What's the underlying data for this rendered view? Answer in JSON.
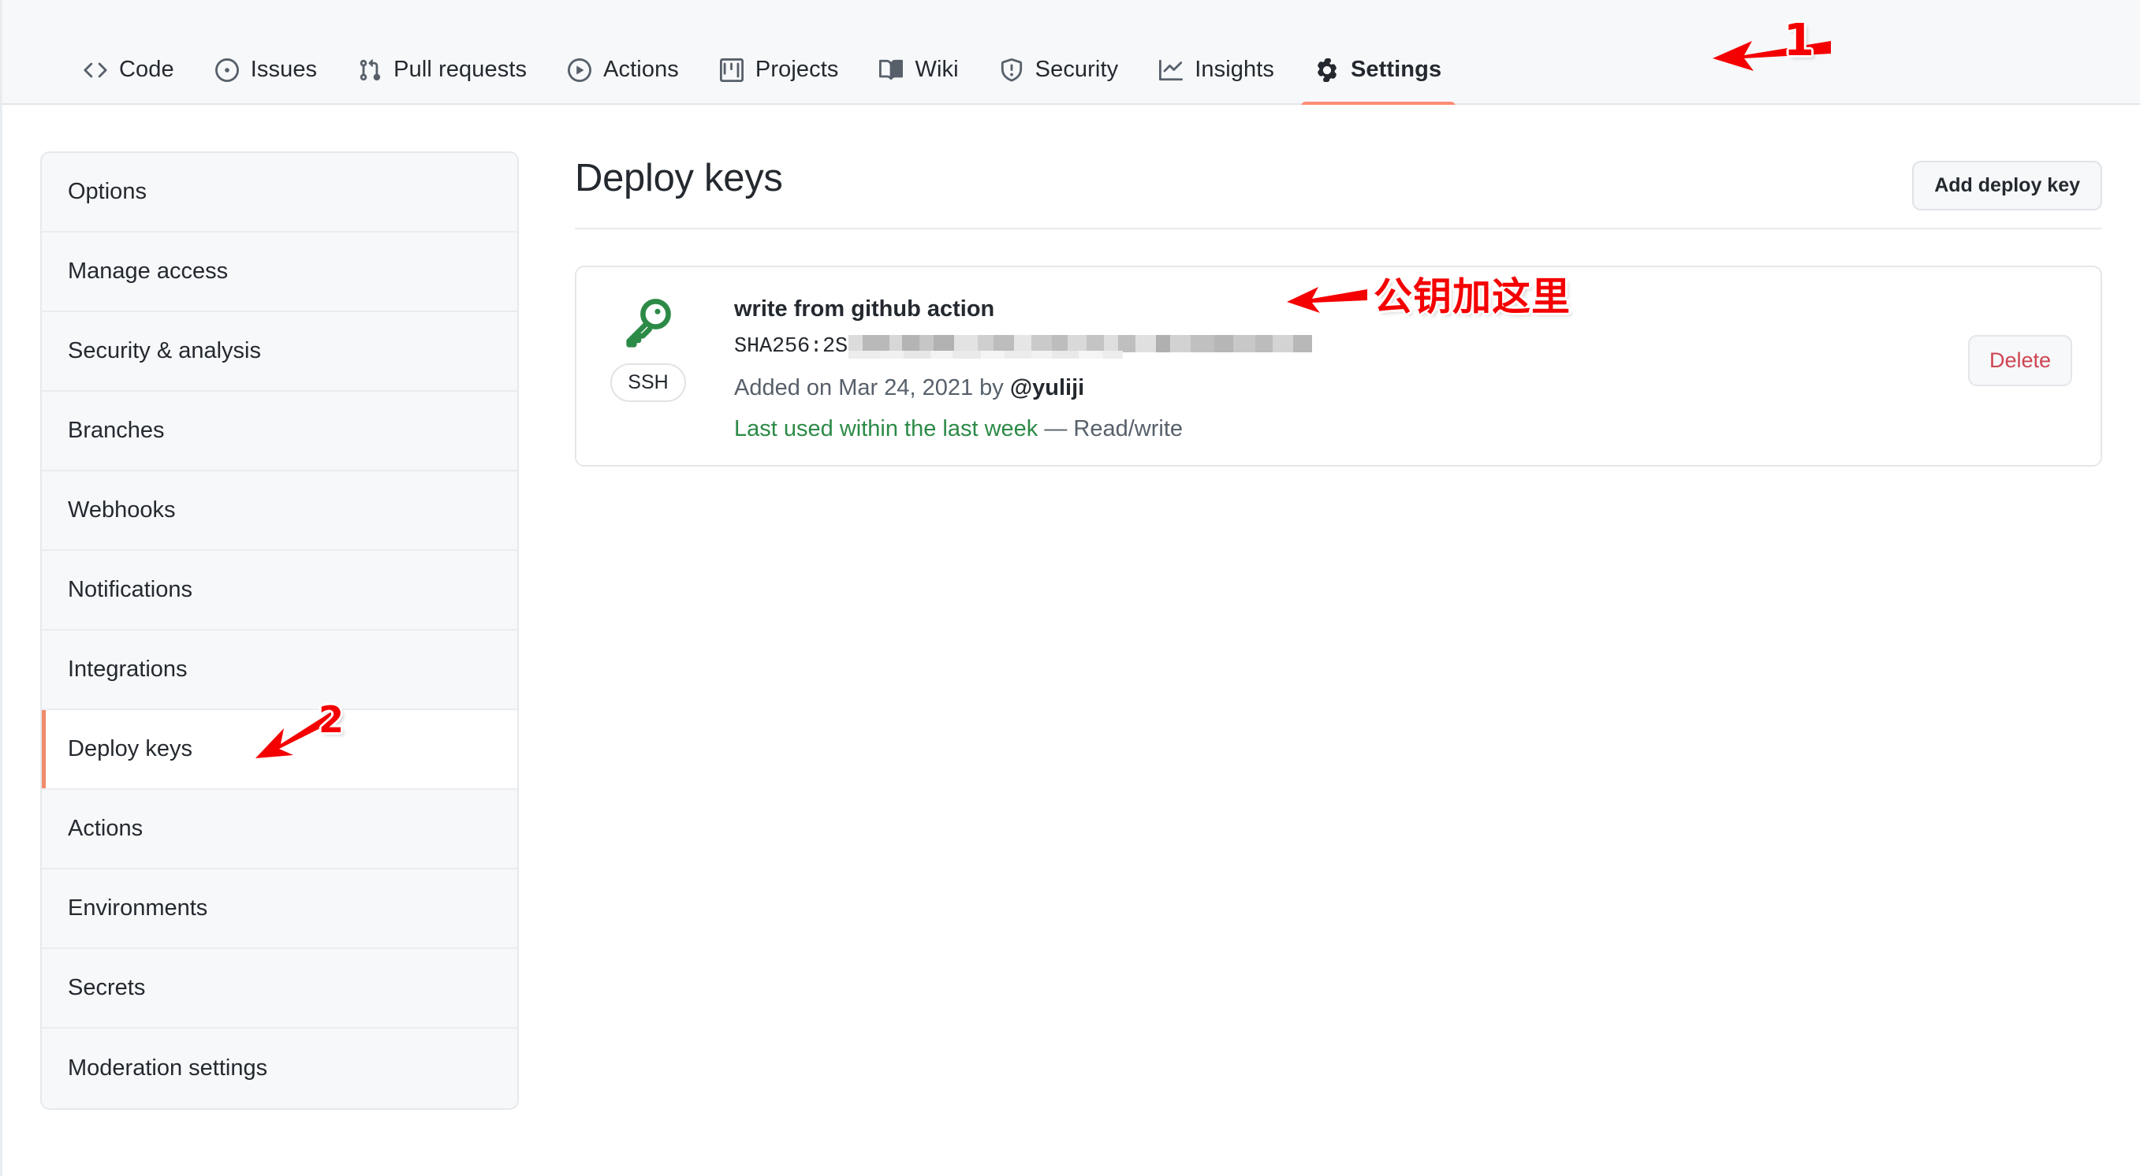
{
  "repo_nav": {
    "items": [
      {
        "label": "Code",
        "icon": "code-icon",
        "active": false
      },
      {
        "label": "Issues",
        "icon": "issue-opened-icon",
        "active": false
      },
      {
        "label": "Pull requests",
        "icon": "git-pull-request-icon",
        "active": false
      },
      {
        "label": "Actions",
        "icon": "play-icon",
        "active": false
      },
      {
        "label": "Projects",
        "icon": "project-board-icon",
        "active": false
      },
      {
        "label": "Wiki",
        "icon": "book-icon",
        "active": false
      },
      {
        "label": "Security",
        "icon": "shield-icon",
        "active": false
      },
      {
        "label": "Insights",
        "icon": "graph-icon",
        "active": false
      },
      {
        "label": "Settings",
        "icon": "gear-icon",
        "active": true
      }
    ],
    "active_underline_color": "#fd8c73"
  },
  "sidebar": {
    "items": [
      {
        "label": "Options",
        "active": false
      },
      {
        "label": "Manage access",
        "active": false
      },
      {
        "label": "Security & analysis",
        "active": false
      },
      {
        "label": "Branches",
        "active": false
      },
      {
        "label": "Webhooks",
        "active": false
      },
      {
        "label": "Notifications",
        "active": false
      },
      {
        "label": "Integrations",
        "active": false
      },
      {
        "label": "Deploy keys",
        "active": true
      },
      {
        "label": "Actions",
        "active": false
      },
      {
        "label": "Environments",
        "active": false
      },
      {
        "label": "Secrets",
        "active": false
      },
      {
        "label": "Moderation settings",
        "active": false
      }
    ],
    "active_indicator_color": "#f08a6a"
  },
  "main": {
    "title": "Deploy keys",
    "add_key_button": "Add deploy key",
    "deploy_keys": [
      {
        "icon": "key-icon",
        "icon_color": "#2c8a47",
        "type_badge": "SSH",
        "title": "write from github action",
        "fingerprint_prefix": "SHA256:2S",
        "fingerprint_redacted": true,
        "added_text_prefix": "Added on Mar 24, 2021 by ",
        "added_by": "@yuliji",
        "last_used": "Last used within the last week",
        "permission_separator": " — ",
        "permission": "Read/write",
        "delete_button": "Delete",
        "delete_button_color": "#cf4452"
      }
    ]
  },
  "annotations": [
    {
      "name": "step-1",
      "text": "1",
      "color": "#f50000",
      "font_size": 56
    },
    {
      "name": "step-2",
      "text": "2",
      "color": "#f50000",
      "font_size": 46
    },
    {
      "name": "public-key-note",
      "text": "公钥加这里",
      "color": "#f50000",
      "font_size": 49
    }
  ]
}
